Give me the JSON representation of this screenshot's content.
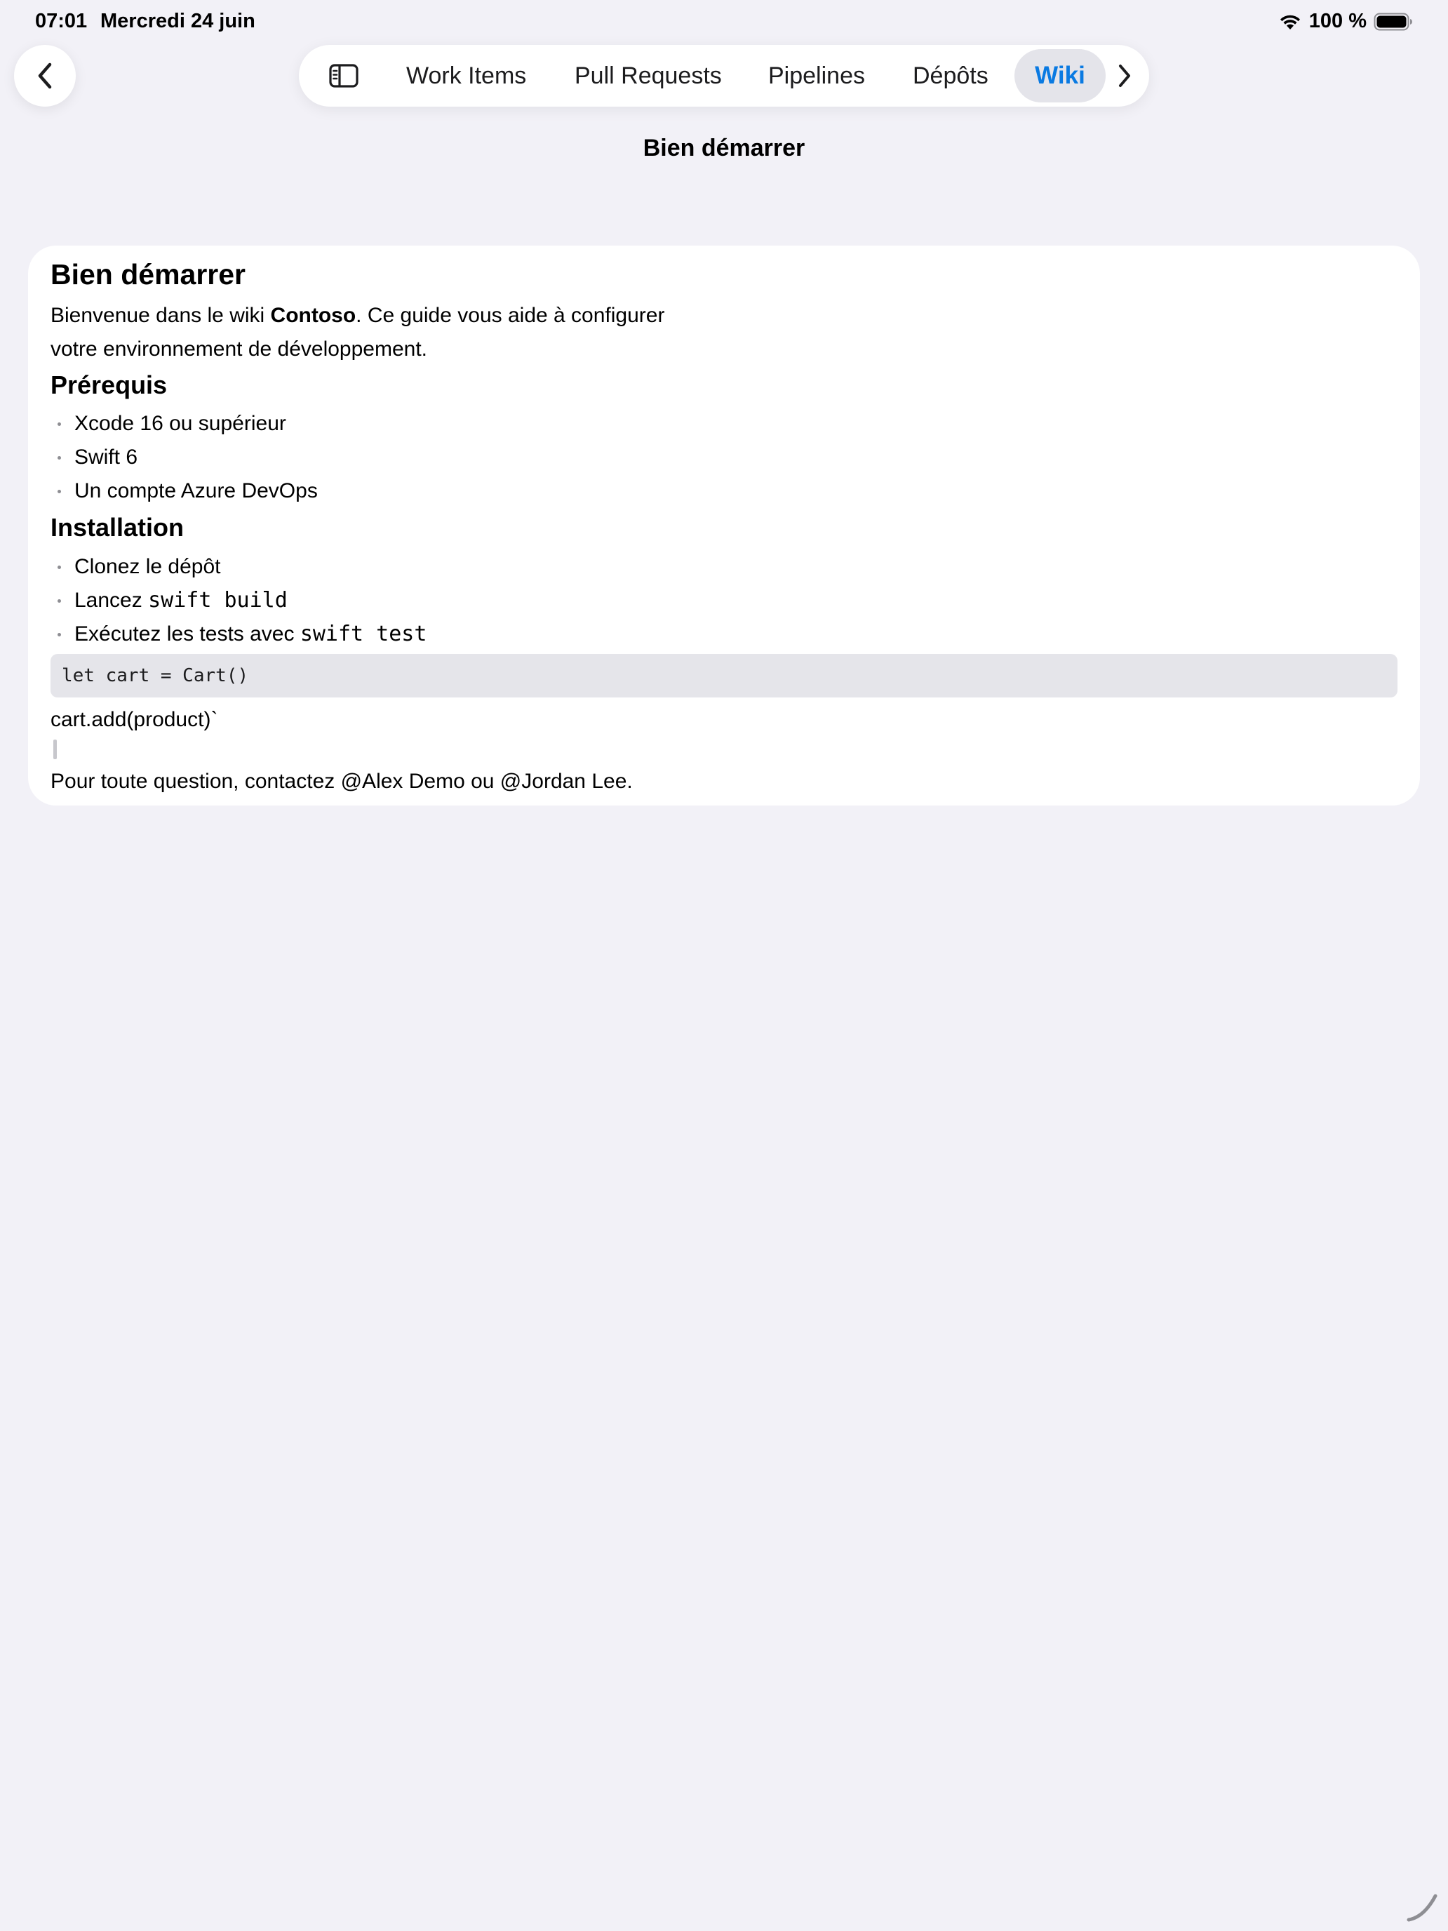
{
  "status_bar": {
    "time": "07:01",
    "date": "Mercredi 24 juin",
    "battery_percent": "100 %"
  },
  "icons": {
    "back": "chevron-left-icon",
    "sidebar": "sidebar-icon",
    "more": "chevron-right-icon",
    "wifi": "wifi-icon",
    "battery": "battery-icon"
  },
  "tabs": [
    {
      "label": "Work Items",
      "selected": false
    },
    {
      "label": "Pull Requests",
      "selected": false
    },
    {
      "label": "Pipelines",
      "selected": false
    },
    {
      "label": "Dépôts",
      "selected": false
    },
    {
      "label": "Wiki",
      "selected": true
    }
  ],
  "nav": {
    "title": "Bien démarrer"
  },
  "document": {
    "title": "Bien démarrer",
    "intro_before": "Bienvenue dans le wiki ",
    "intro_bold": "Contoso",
    "intro_after": ". Ce guide vous aide à configurer votre environnement de développement.",
    "prereq_heading": "Prérequis",
    "prereq_items": [
      "Xcode 16 ou supérieur",
      "Swift 6",
      "Un compte Azure DevOps"
    ],
    "install_heading": "Installation",
    "install_items": [
      {
        "text": "Clonez le dépôt",
        "code": ""
      },
      {
        "text": "Lancez ",
        "code": "swift build"
      },
      {
        "text": "Exécutez les tests avec ",
        "code": "swift test"
      }
    ],
    "code_block": "let cart = Cart()",
    "code_after": "cart.add(product)`",
    "footer": "Pour toute question, contactez @Alex Demo ou @Jordan Lee."
  },
  "colors": {
    "background": "#f2f1f7",
    "accent": "#0a7ae2",
    "selected_pill": "#e4e4ea",
    "code_background": "#e5e5ea"
  }
}
